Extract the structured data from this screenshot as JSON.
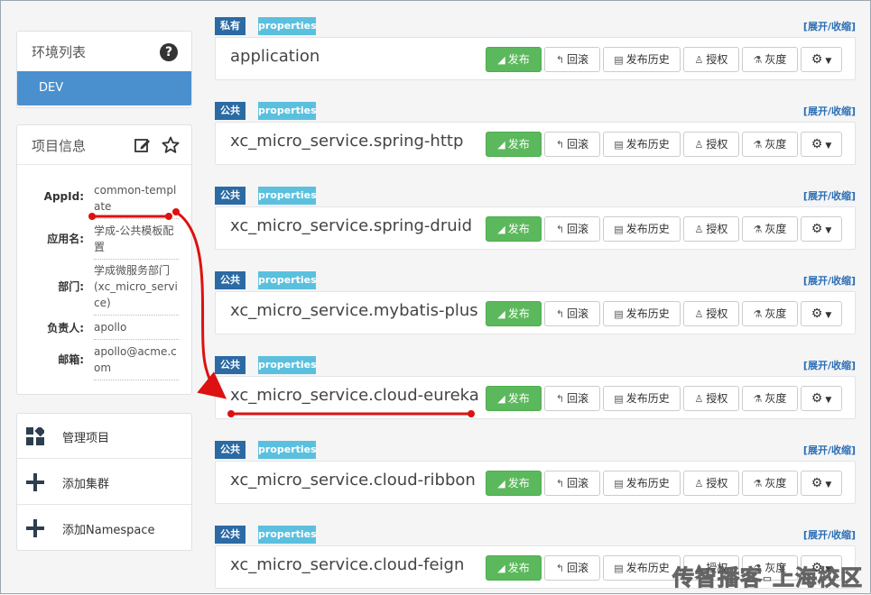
{
  "env": {
    "title": "环境列表",
    "items": [
      "DEV"
    ]
  },
  "project": {
    "title": "项目信息",
    "fields": [
      {
        "label": "AppId:",
        "value": "common-template"
      },
      {
        "label": "应用名:",
        "value": "学成-公共模板配置"
      },
      {
        "label": "部门:",
        "value": "学成微服务部门(xc_micro_service)"
      },
      {
        "label": "负责人:",
        "value": "apollo"
      },
      {
        "label": "邮箱:",
        "value": "apollo@acme.com"
      }
    ]
  },
  "actions": [
    "管理项目",
    "添加集群",
    "添加Namespace"
  ],
  "toggle_label": "[展开/收缩]",
  "buttons": {
    "publish": "发布",
    "rollback": "回滚",
    "history": "发布历史",
    "auth": "授权",
    "gray": "灰度"
  },
  "namespaces": [
    {
      "scope": "私有",
      "format": "properties",
      "name": "application"
    },
    {
      "scope": "公共",
      "format": "properties",
      "name": "xc_micro_service.spring-http"
    },
    {
      "scope": "公共",
      "format": "properties",
      "name": "xc_micro_service.spring-druid"
    },
    {
      "scope": "公共",
      "format": "properties",
      "name": "xc_micro_service.mybatis-plus"
    },
    {
      "scope": "公共",
      "format": "properties",
      "name": "xc_micro_service.cloud-eureka"
    },
    {
      "scope": "公共",
      "format": "properties",
      "name": "xc_micro_service.cloud-ribbon"
    },
    {
      "scope": "公共",
      "format": "properties",
      "name": "xc_micro_service.cloud-feign"
    }
  ],
  "watermark": "传智播客-上海校区",
  "colors": {
    "primary": "#4a90cf",
    "publish": "#5cb85c",
    "scope_tag": "#2b6aa3",
    "format_tag": "#5bc0de",
    "annotation": "#dd1111"
  }
}
